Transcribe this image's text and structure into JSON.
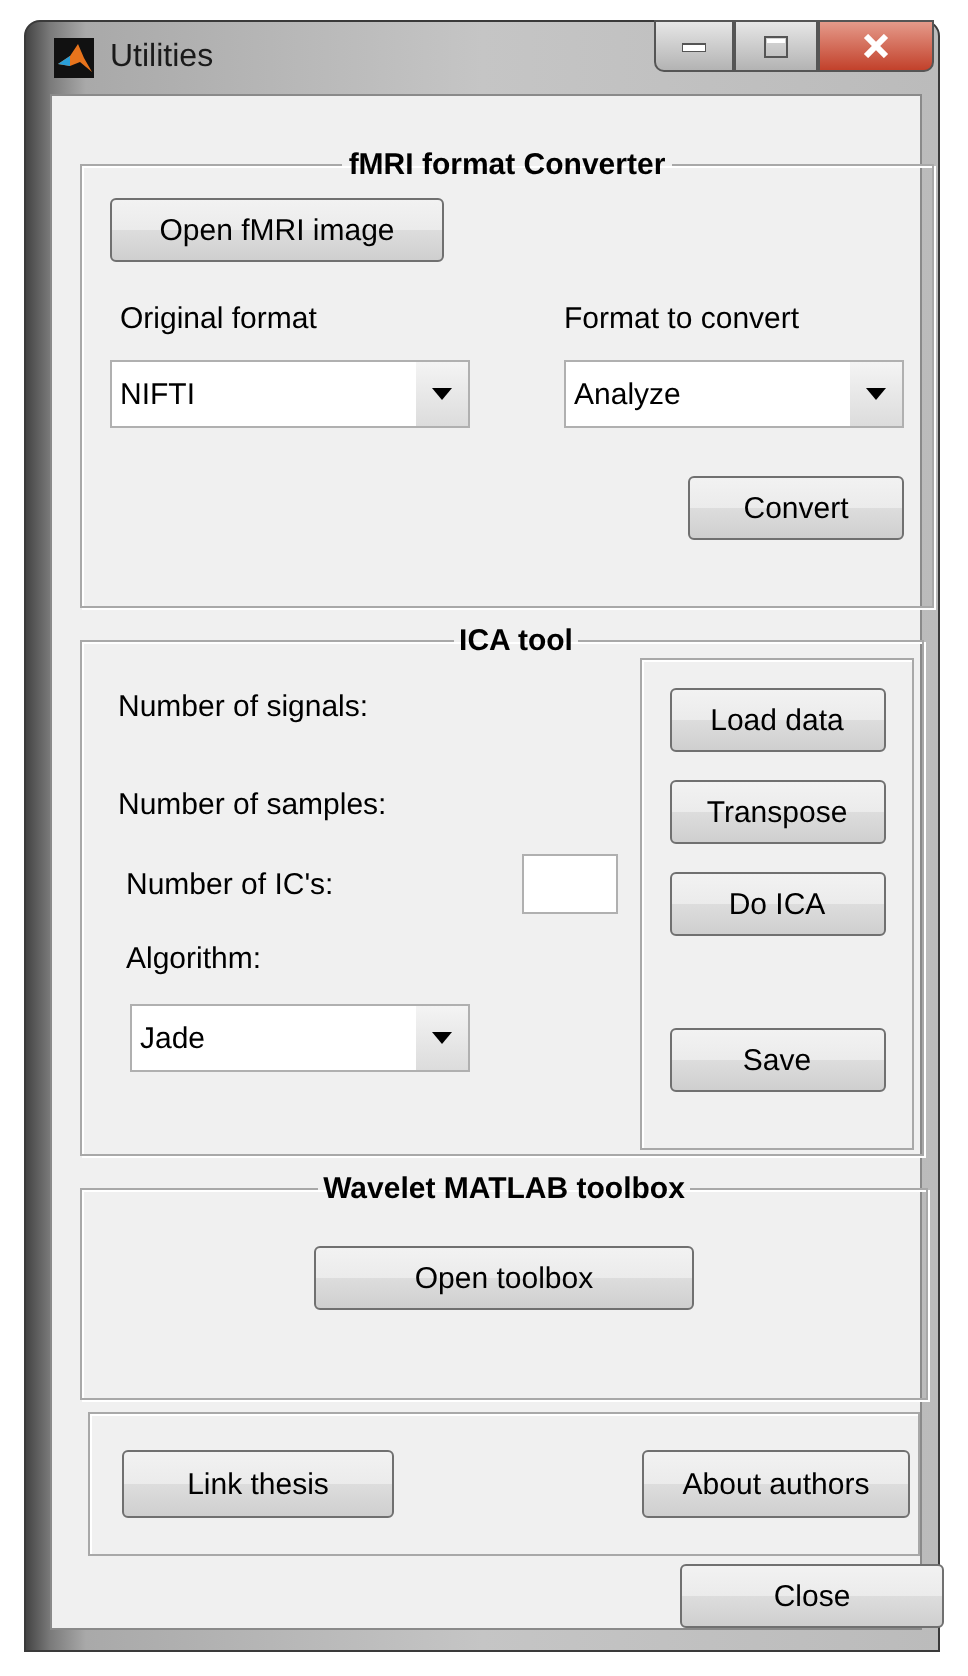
{
  "window": {
    "title": "Utilities"
  },
  "fmri_converter": {
    "title": "fMRI format Converter",
    "open_button": "Open fMRI image",
    "original_format_label": "Original format",
    "original_format_value": "NIFTI",
    "target_format_label": "Format to convert",
    "target_format_value": "Analyze",
    "convert_button": "Convert"
  },
  "ica_tool": {
    "title": "ICA tool",
    "signals_label": "Number of signals:",
    "samples_label": "Number of samples:",
    "ics_label": "Number of IC's:",
    "algorithm_label": "Algorithm:",
    "algorithm_value": "Jade",
    "buttons": [
      "Load data",
      "Transpose",
      "Do ICA",
      "Save"
    ]
  },
  "wavelet": {
    "title": "Wavelet MATLAB toolbox",
    "button": "Open toolbox"
  },
  "footer": {
    "buttons": [
      "Link thesis",
      "About authors"
    ]
  },
  "close_button": "Close"
}
